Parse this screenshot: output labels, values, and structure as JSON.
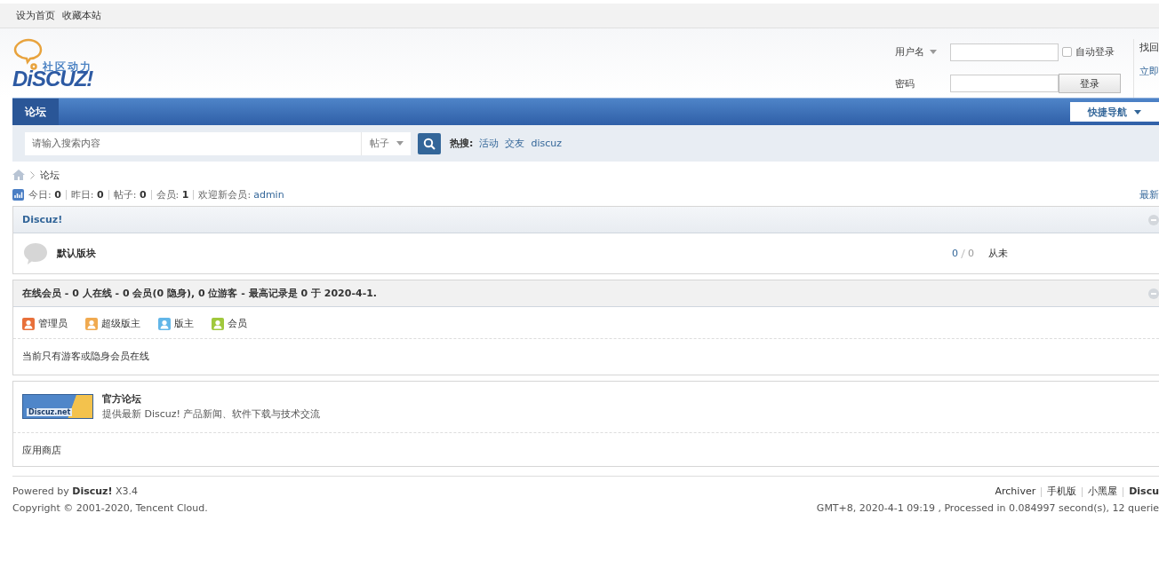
{
  "topbar": {
    "links": [
      "设为首页",
      "收藏本站"
    ]
  },
  "logo": {
    "tagline": "社区动力",
    "wordmark": "DiSCUZ!"
  },
  "login": {
    "username_label": "用户名",
    "password_label": "密码",
    "auto_login": {
      "label": "自动登录",
      "checked": false
    },
    "login_button": "登录",
    "forgot_link": "找回",
    "register_link": "立即"
  },
  "nav": {
    "tabs": [
      {
        "label": "论坛",
        "selected": true
      }
    ],
    "quick_nav": "快捷导航"
  },
  "search": {
    "placeholder": "请输入搜索内容",
    "scope": "帖子",
    "hot_label": "热搜:",
    "hot_terms": [
      "活动",
      "交友",
      "discuz"
    ]
  },
  "breadcrumb": [
    "论坛"
  ],
  "stats": {
    "items": [
      {
        "label": "今日:",
        "value": "0"
      },
      {
        "label": "昨日:",
        "value": "0"
      },
      {
        "label": "帖子:",
        "value": "0"
      },
      {
        "label": "会员:",
        "value": "1"
      }
    ],
    "welcome_label": "欢迎新会员:",
    "newest_member": "admin",
    "latest_link": "最新"
  },
  "categories": [
    {
      "title": "Discuz!",
      "forums": [
        {
          "name": "默认版块",
          "threads": "0",
          "posts": "0",
          "last_post": "从未"
        }
      ]
    }
  ],
  "online": {
    "summary": "在线会员 - 0 人在线 - 0 会员(0 隐身), 0 位游客 - 最高记录是 0 于 2020-4-1.",
    "legend": [
      {
        "label": "管理员",
        "color": "#e8703a"
      },
      {
        "label": "超级版主",
        "color": "#f0aa50"
      },
      {
        "label": "版主",
        "color": "#62b6e8"
      },
      {
        "label": "会员",
        "color": "#a0c83c"
      }
    ],
    "note": "当前只有游客或隐身会员在线"
  },
  "friend_links": {
    "featured": [
      {
        "title": "官方论坛",
        "description": "提供最新 Discuz! 产品新闻、软件下载与技术交流",
        "banner": "Discuz.net"
      }
    ],
    "text_links": [
      "应用商店"
    ]
  },
  "footer": {
    "powered": "Powered by **Discuz!** X3.4",
    "copyright": "Copyright © 2001-2020, Tencent Cloud.",
    "links": [
      {
        "label": "Archiver",
        "bold": false
      },
      {
        "label": "手机版",
        "bold": false
      },
      {
        "label": "小黑屋",
        "bold": false
      },
      {
        "label": "Discu",
        "bold": true
      }
    ],
    "timing": "GMT+8, 2020-4-1 09:19 , Processed in 0.084997 second(s), 12 querie"
  }
}
